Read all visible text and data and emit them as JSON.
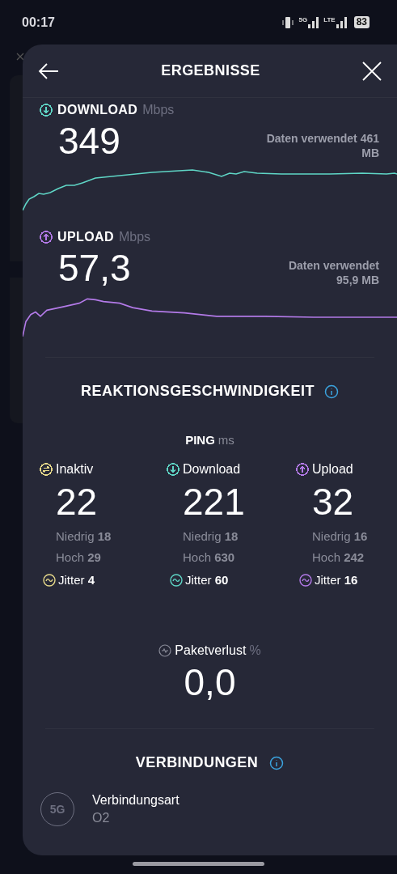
{
  "status_bar": {
    "time": "00:17",
    "network_labels": [
      "5G",
      "LTE"
    ],
    "battery": "83"
  },
  "header": {
    "title": "ERGEBNISSE"
  },
  "speeds": [
    {
      "kind": "download",
      "label": "DOWNLOAD",
      "unit": "Mbps",
      "value": "349",
      "data_used": [
        "Daten verwendet 461",
        "MB"
      ],
      "color": "#5fd6c6"
    },
    {
      "kind": "upload",
      "label": "UPLOAD",
      "unit": "Mbps",
      "value": "57,3",
      "data_used": [
        "Daten verwendet",
        "95,9 MB"
      ],
      "color": "#b37ae8"
    }
  ],
  "responsiveness": {
    "title": "REAKTIONSGESCHWINDIGKEIT",
    "ping_label": "PING",
    "ping_unit": "ms",
    "columns": [
      {
        "kind": "idle",
        "label": "Inaktiv",
        "value": "22",
        "low": "Niedrig **18**",
        "high": "Hoch **29**",
        "jitter": "Jitter **4**",
        "color": "#e6d98a"
      },
      {
        "kind": "download",
        "label": "Download",
        "value": "221",
        "low": "Niedrig **18**",
        "high": "Hoch **630**",
        "jitter": "Jitter **60**",
        "color": "#5fd6c6"
      },
      {
        "kind": "upload",
        "label": "Upload",
        "value": "32",
        "low": "Niedrig **16**",
        "high": "Hoch **242**",
        "jitter": "Jitter **16**",
        "color": "#b37ae8"
      }
    ],
    "packet_loss": {
      "label": "Paketverlust",
      "unit": "%",
      "value": "0,0"
    }
  },
  "connections": {
    "title": "VERBINDUNGEN",
    "items": [
      {
        "badge": "5G",
        "label": "Verbindungsart",
        "value": "O2"
      }
    ]
  }
}
